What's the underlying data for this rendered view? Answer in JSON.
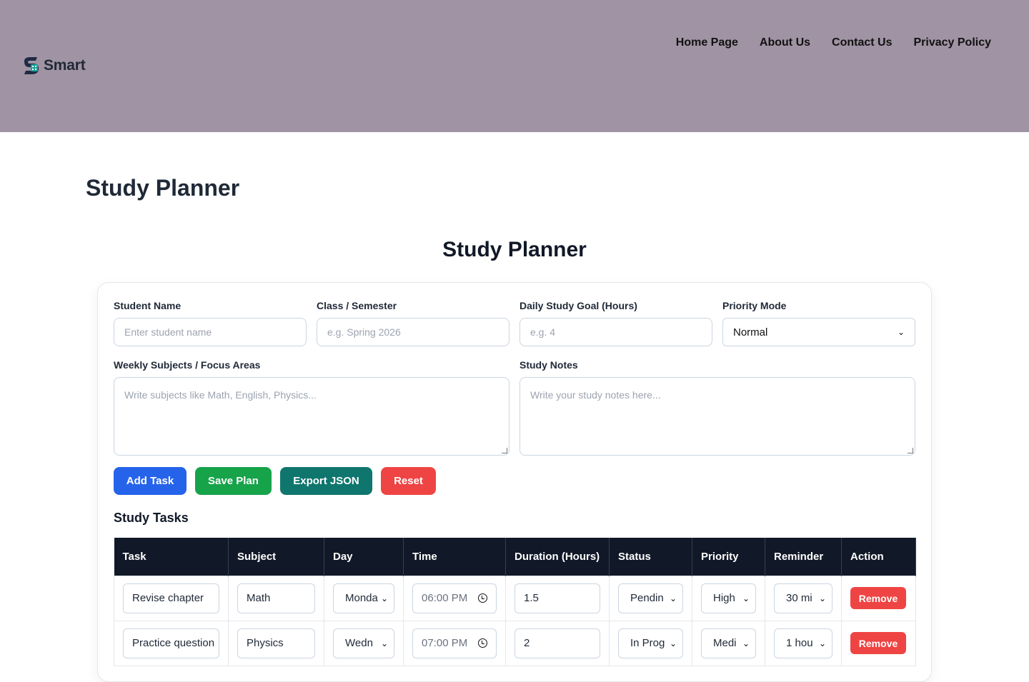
{
  "header": {
    "logo_text": "Smart",
    "nav": [
      "Home Page",
      "About Us",
      "Contact Us",
      "Privacy Policy"
    ]
  },
  "page": {
    "title": "Study Planner",
    "section_title": "Study Planner"
  },
  "form": {
    "student_name": {
      "label": "Student Name",
      "placeholder": "Enter student name"
    },
    "class_semester": {
      "label": "Class / Semester",
      "placeholder": "e.g. Spring 2026"
    },
    "daily_goal": {
      "label": "Daily Study Goal (Hours)",
      "placeholder": "e.g. 4"
    },
    "priority_mode": {
      "label": "Priority Mode",
      "value": "Normal"
    },
    "weekly_subjects": {
      "label": "Weekly Subjects / Focus Areas",
      "placeholder": "Write subjects like Math, English, Physics..."
    },
    "study_notes": {
      "label": "Study Notes",
      "placeholder": "Write your study notes here..."
    }
  },
  "buttons": {
    "add_task": "Add Task",
    "save_plan": "Save Plan",
    "export_json": "Export JSON",
    "reset": "Reset"
  },
  "colors": {
    "header_bg": "#a093a3",
    "add_task": "#2563eb",
    "save_plan": "#16a34a",
    "export_json": "#0f766e",
    "reset": "#ef4444",
    "table_header": "#111827"
  },
  "tasks": {
    "heading": "Study Tasks",
    "columns": [
      "Task",
      "Subject",
      "Day",
      "Time",
      "Duration (Hours)",
      "Status",
      "Priority",
      "Reminder",
      "Action"
    ],
    "rows": [
      {
        "task": "Revise chapter",
        "subject": "Math",
        "day": "Monda",
        "time": "06:00 PM",
        "duration": "1.5",
        "status": "Pendin",
        "priority": "High",
        "reminder": "30 mi",
        "action": "Remove"
      },
      {
        "task": "Practice question",
        "subject": "Physics",
        "day": "Wedn",
        "time": "07:00 PM",
        "duration": "2",
        "status": "In Prog",
        "priority": "Medi",
        "reminder": "1 hou",
        "action": "Remove"
      }
    ]
  }
}
